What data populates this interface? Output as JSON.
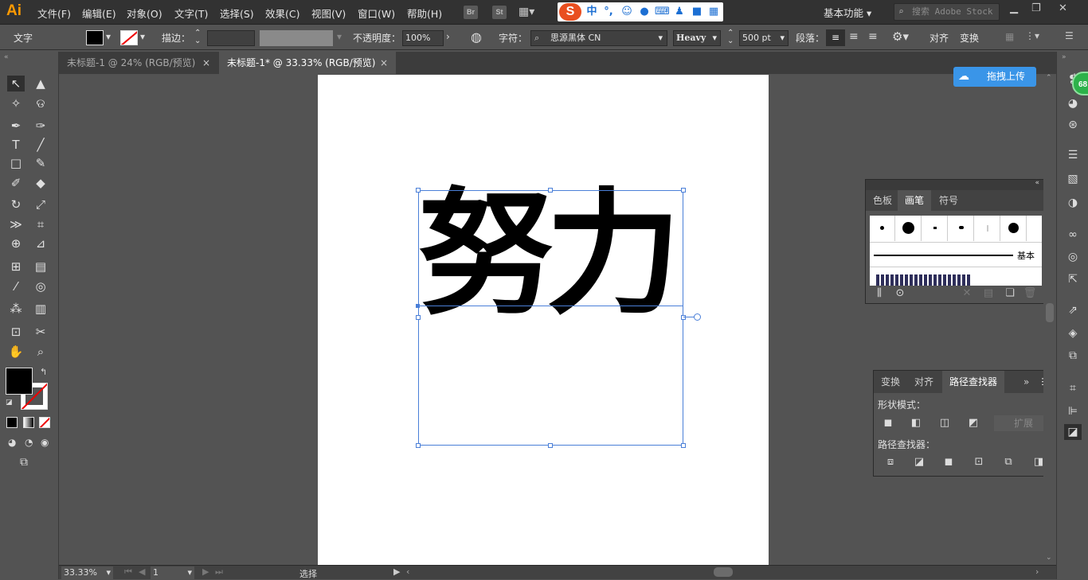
{
  "app": {
    "logo": "Ai"
  },
  "menu": [
    "文件(F)",
    "编辑(E)",
    "对象(O)",
    "文字(T)",
    "选择(S)",
    "效果(C)",
    "视图(V)",
    "窗口(W)",
    "帮助(H)"
  ],
  "bridge": {
    "br": "Br",
    "st": "St"
  },
  "ime": {
    "logo": "S",
    "lang": "中",
    "punct": "°,",
    "icons": [
      "smile-icon",
      "mic-icon",
      "keyboard-icon",
      "user-icon",
      "shirt-icon",
      "grid-icon"
    ]
  },
  "workspace": {
    "label": "基本功能"
  },
  "stock_search": {
    "placeholder": "搜索 Adobe Stock"
  },
  "control_bar": {
    "mode": "文字",
    "stroke_label": "描边：",
    "opacity_label": "不透明度：",
    "opacity_value": "100%",
    "character_label": "字符：",
    "font_family": "思源黑体 CN",
    "font_style": "Heavy",
    "font_size": "500 pt",
    "paragraph_label": "段落：",
    "align_label": "对齐",
    "transform_label": "变换"
  },
  "tabs": [
    {
      "label": "未标题-1 @ 24% (RGB/预览)",
      "active": false
    },
    {
      "label": "未标题-1* @ 33.33% (RGB/预览)",
      "active": true
    }
  ],
  "artboard": {
    "text": "努力"
  },
  "upload_button": {
    "label": "拖拽上传"
  },
  "badge": {
    "value": "68"
  },
  "brush_panel": {
    "tabs": [
      "色板",
      "画笔",
      "符号"
    ],
    "active_tab": "画笔",
    "basic_label": "基本"
  },
  "pathfinder_panel": {
    "tabs": [
      "变换",
      "对齐",
      "路径查找器"
    ],
    "active_tab": "路径查找器",
    "shape_modes_label": "形状模式：",
    "expand_label": "扩展",
    "pathfinders_label": "路径查找器："
  },
  "status": {
    "zoom": "33.33%",
    "page": "1",
    "tool": "选择"
  },
  "colors": {
    "accent": "#4a7fd8",
    "logo": "#ff9a00",
    "upload": "#3a95e8",
    "badge": "#2db24a"
  }
}
